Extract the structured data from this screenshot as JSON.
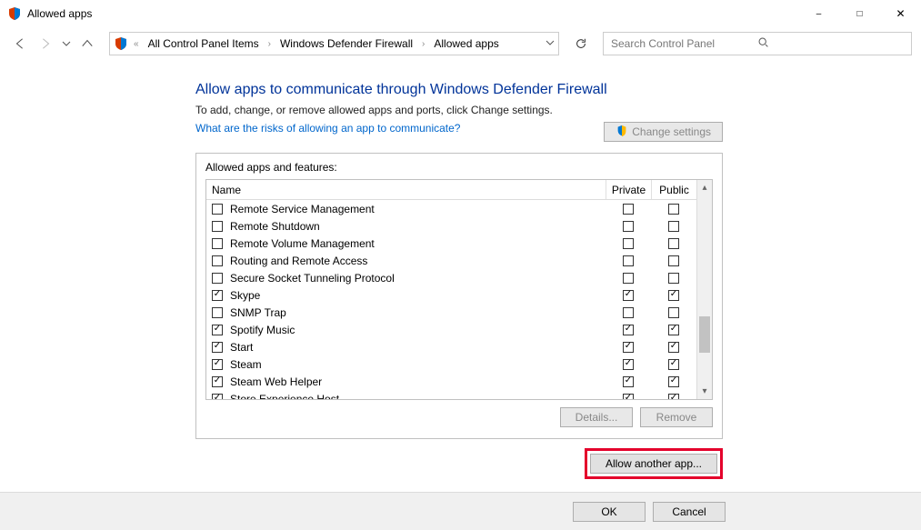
{
  "window": {
    "title": "Allowed apps"
  },
  "breadcrumb": {
    "items": [
      "All Control Panel Items",
      "Windows Defender Firewall",
      "Allowed apps"
    ]
  },
  "search": {
    "placeholder": "Search Control Panel"
  },
  "page": {
    "heading": "Allow apps to communicate through Windows Defender Firewall",
    "subhead": "To add, change, or remove allowed apps and ports, click Change settings.",
    "risk_link": "What are the risks of allowing an app to communicate?",
    "change_settings": "Change settings",
    "panel_label": "Allowed apps and features:",
    "col_name": "Name",
    "col_private": "Private",
    "col_public": "Public",
    "details_btn": "Details...",
    "remove_btn": "Remove",
    "allow_another": "Allow another app...",
    "ok": "OK",
    "cancel": "Cancel"
  },
  "apps": [
    {
      "name": "Remote Service Management",
      "enabled": false,
      "private": false,
      "public": false
    },
    {
      "name": "Remote Shutdown",
      "enabled": false,
      "private": false,
      "public": false
    },
    {
      "name": "Remote Volume Management",
      "enabled": false,
      "private": false,
      "public": false
    },
    {
      "name": "Routing and Remote Access",
      "enabled": false,
      "private": false,
      "public": false
    },
    {
      "name": "Secure Socket Tunneling Protocol",
      "enabled": false,
      "private": false,
      "public": false
    },
    {
      "name": "Skype",
      "enabled": true,
      "private": true,
      "public": true
    },
    {
      "name": "SNMP Trap",
      "enabled": false,
      "private": false,
      "public": false
    },
    {
      "name": "Spotify Music",
      "enabled": true,
      "private": true,
      "public": true
    },
    {
      "name": "Start",
      "enabled": true,
      "private": true,
      "public": true
    },
    {
      "name": "Steam",
      "enabled": true,
      "private": true,
      "public": true
    },
    {
      "name": "Steam Web Helper",
      "enabled": true,
      "private": true,
      "public": true
    },
    {
      "name": "Store Experience Host",
      "enabled": true,
      "private": true,
      "public": true
    }
  ]
}
